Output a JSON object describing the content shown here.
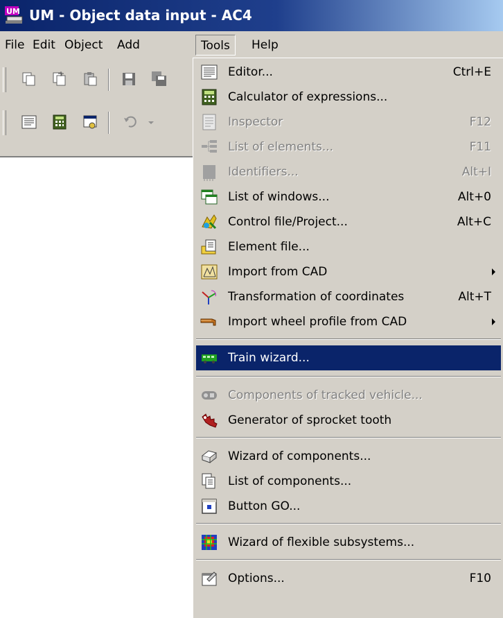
{
  "window": {
    "title": "UM - Object data input - AC4",
    "app_icon": "um-app-icon"
  },
  "menubar": {
    "items": [
      {
        "label": "File"
      },
      {
        "label": "Edit"
      },
      {
        "label": "Object"
      },
      {
        "label": "Add"
      },
      {
        "label": "Tools",
        "active": true
      },
      {
        "label": "Help"
      }
    ]
  },
  "toolbar1": {
    "icons": [
      "copy-icon",
      "copy-element-icon",
      "paste-icon",
      "save-icon",
      "save-all-icon"
    ]
  },
  "toolbar2": {
    "icons": [
      "editor-icon",
      "calculator-icon",
      "inspector-icon",
      "undo-icon",
      "undo-dropdown-icon"
    ]
  },
  "tools_menu": {
    "items": [
      {
        "label": "Editor...",
        "shortcut": "Ctrl+E",
        "icon": "editor-icon",
        "enabled": true
      },
      {
        "label": "Calculator of expressions...",
        "shortcut": "",
        "icon": "calculator-icon",
        "enabled": true
      },
      {
        "label": "Inspector",
        "shortcut": "F12",
        "icon": "inspector-icon",
        "enabled": false
      },
      {
        "label": "List of elements...",
        "shortcut": "F11",
        "icon": "list-elements-icon",
        "enabled": false
      },
      {
        "label": "Identifiers...",
        "shortcut": "Alt+I",
        "icon": "identifiers-icon",
        "enabled": false
      },
      {
        "label": "List of windows...",
        "shortcut": "Alt+0",
        "icon": "windows-icon",
        "enabled": true
      },
      {
        "label": "Control file/Project...",
        "shortcut": "Alt+C",
        "icon": "control-file-icon",
        "enabled": true
      },
      {
        "label": "Element file...",
        "shortcut": "",
        "icon": "element-file-icon",
        "enabled": true
      },
      {
        "label": "Import from CAD",
        "shortcut": "",
        "icon": "import-cad-icon",
        "enabled": true,
        "submenu": true
      },
      {
        "label": "Transformation of coordinates",
        "shortcut": "Alt+T",
        "icon": "coordinates-icon",
        "enabled": true
      },
      {
        "label": "Import wheel profile from CAD",
        "shortcut": "",
        "icon": "wheel-profile-icon",
        "enabled": true,
        "submenu": true
      },
      {
        "label": "Train wizard...",
        "shortcut": "",
        "icon": "train-icon",
        "enabled": true,
        "highlighted": true
      },
      {
        "label": "Components of tracked vehicle...",
        "shortcut": "",
        "icon": "tracked-vehicle-icon",
        "enabled": false
      },
      {
        "label": "Generator of sprocket tooth",
        "shortcut": "",
        "icon": "sprocket-icon",
        "enabled": true
      },
      {
        "label": "Wizard of components...",
        "shortcut": "",
        "icon": "wizard-components-icon",
        "enabled": true
      },
      {
        "label": "List of components...",
        "shortcut": "",
        "icon": "list-components-icon",
        "enabled": true
      },
      {
        "label": "Button GO...",
        "shortcut": "",
        "icon": "button-go-icon",
        "enabled": true
      },
      {
        "label": "Wizard of flexible subsystems...",
        "shortcut": "",
        "icon": "flexible-subsystems-icon",
        "enabled": true
      },
      {
        "label": "Options...",
        "shortcut": "F10",
        "icon": "options-icon",
        "enabled": true
      }
    ]
  }
}
